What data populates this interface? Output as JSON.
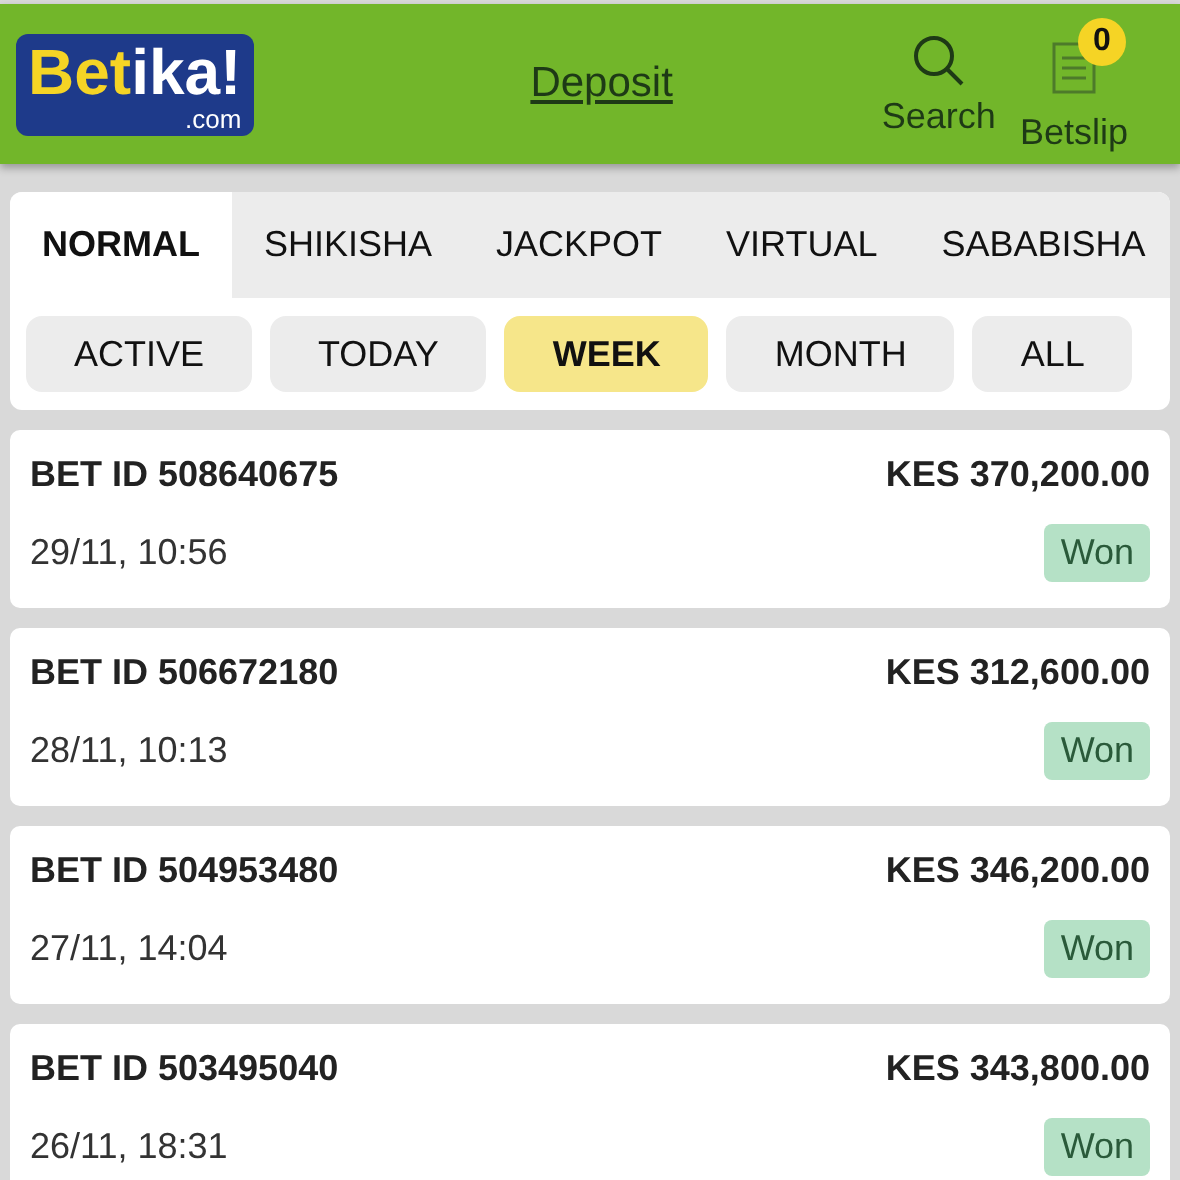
{
  "header": {
    "logo_parts": [
      {
        "text": "Bet",
        "color": "#f5d425"
      },
      {
        "text": "ika!",
        "color": "#ffffff"
      }
    ],
    "logo_domain": ".com",
    "deposit": "Deposit",
    "search": "Search",
    "betslip": "Betslip",
    "betslip_count": "0"
  },
  "tabs": [
    {
      "label": "NORMAL",
      "selected": true
    },
    {
      "label": "SHIKISHA",
      "selected": false
    },
    {
      "label": "JACKPOT",
      "selected": false
    },
    {
      "label": "VIRTUAL",
      "selected": false
    },
    {
      "label": "SABABISHA",
      "selected": false
    }
  ],
  "filters": [
    {
      "label": "ACTIVE",
      "selected": false
    },
    {
      "label": "TODAY",
      "selected": false
    },
    {
      "label": "WEEK",
      "selected": true
    },
    {
      "label": "MONTH",
      "selected": false
    },
    {
      "label": "ALL",
      "selected": false
    }
  ],
  "bets": [
    {
      "id": "BET ID 508640675",
      "amount": "KES 370,200.00",
      "time": "29/11, 10:56",
      "status": "Won"
    },
    {
      "id": "BET ID 506672180",
      "amount": "KES 312,600.00",
      "time": "28/11, 10:13",
      "status": "Won"
    },
    {
      "id": "BET ID 504953480",
      "amount": "KES 346,200.00",
      "time": "27/11, 14:04",
      "status": "Won"
    },
    {
      "id": "BET ID 503495040",
      "amount": "KES 343,800.00",
      "time": "26/11, 18:31",
      "status": "Won"
    }
  ]
}
